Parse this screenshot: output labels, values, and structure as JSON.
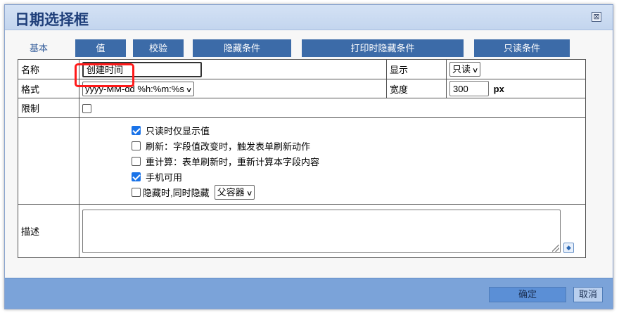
{
  "dialog": {
    "title": "日期选择框",
    "close_symbol": "⊠"
  },
  "tabs": [
    {
      "label": "基本",
      "active": true
    },
    {
      "label": "值",
      "active": false
    },
    {
      "label": "校验",
      "active": false
    },
    {
      "label": "隐藏条件",
      "active": false
    },
    {
      "label": "打印时隐藏条件",
      "active": false
    },
    {
      "label": "只读条件",
      "active": false
    }
  ],
  "form": {
    "name_label": "名称",
    "name_value": "创建时间",
    "display_label": "显示",
    "display_value": "只读",
    "format_label": "格式",
    "format_value": "yyyy-MM-dd %h:%m:%s",
    "width_label": "宽度",
    "width_value": "300",
    "width_unit": "px",
    "limit_label": "限制",
    "limit_checked": false,
    "options": [
      {
        "label": "只读时仅显示值",
        "checked": true
      },
      {
        "label": "刷新：字段值改变时，触发表单刷新动作",
        "checked": false
      },
      {
        "label": "重计算：表单刷新时，重新计算本字段内容",
        "checked": false
      },
      {
        "label": "手机可用",
        "checked": true
      },
      {
        "label": "隐藏时,同时隐藏",
        "checked": false
      }
    ],
    "hide_with_value": "父容器",
    "desc_label": "描述",
    "desc_value": ""
  },
  "footer": {
    "ok_label": "确定",
    "cancel_label": "取消"
  },
  "colors": {
    "tab_bg": "#3c6ba8",
    "footer_bg": "#7ba3d9",
    "highlight": "#ff1a1a",
    "check_blue": "#1a73e8"
  }
}
